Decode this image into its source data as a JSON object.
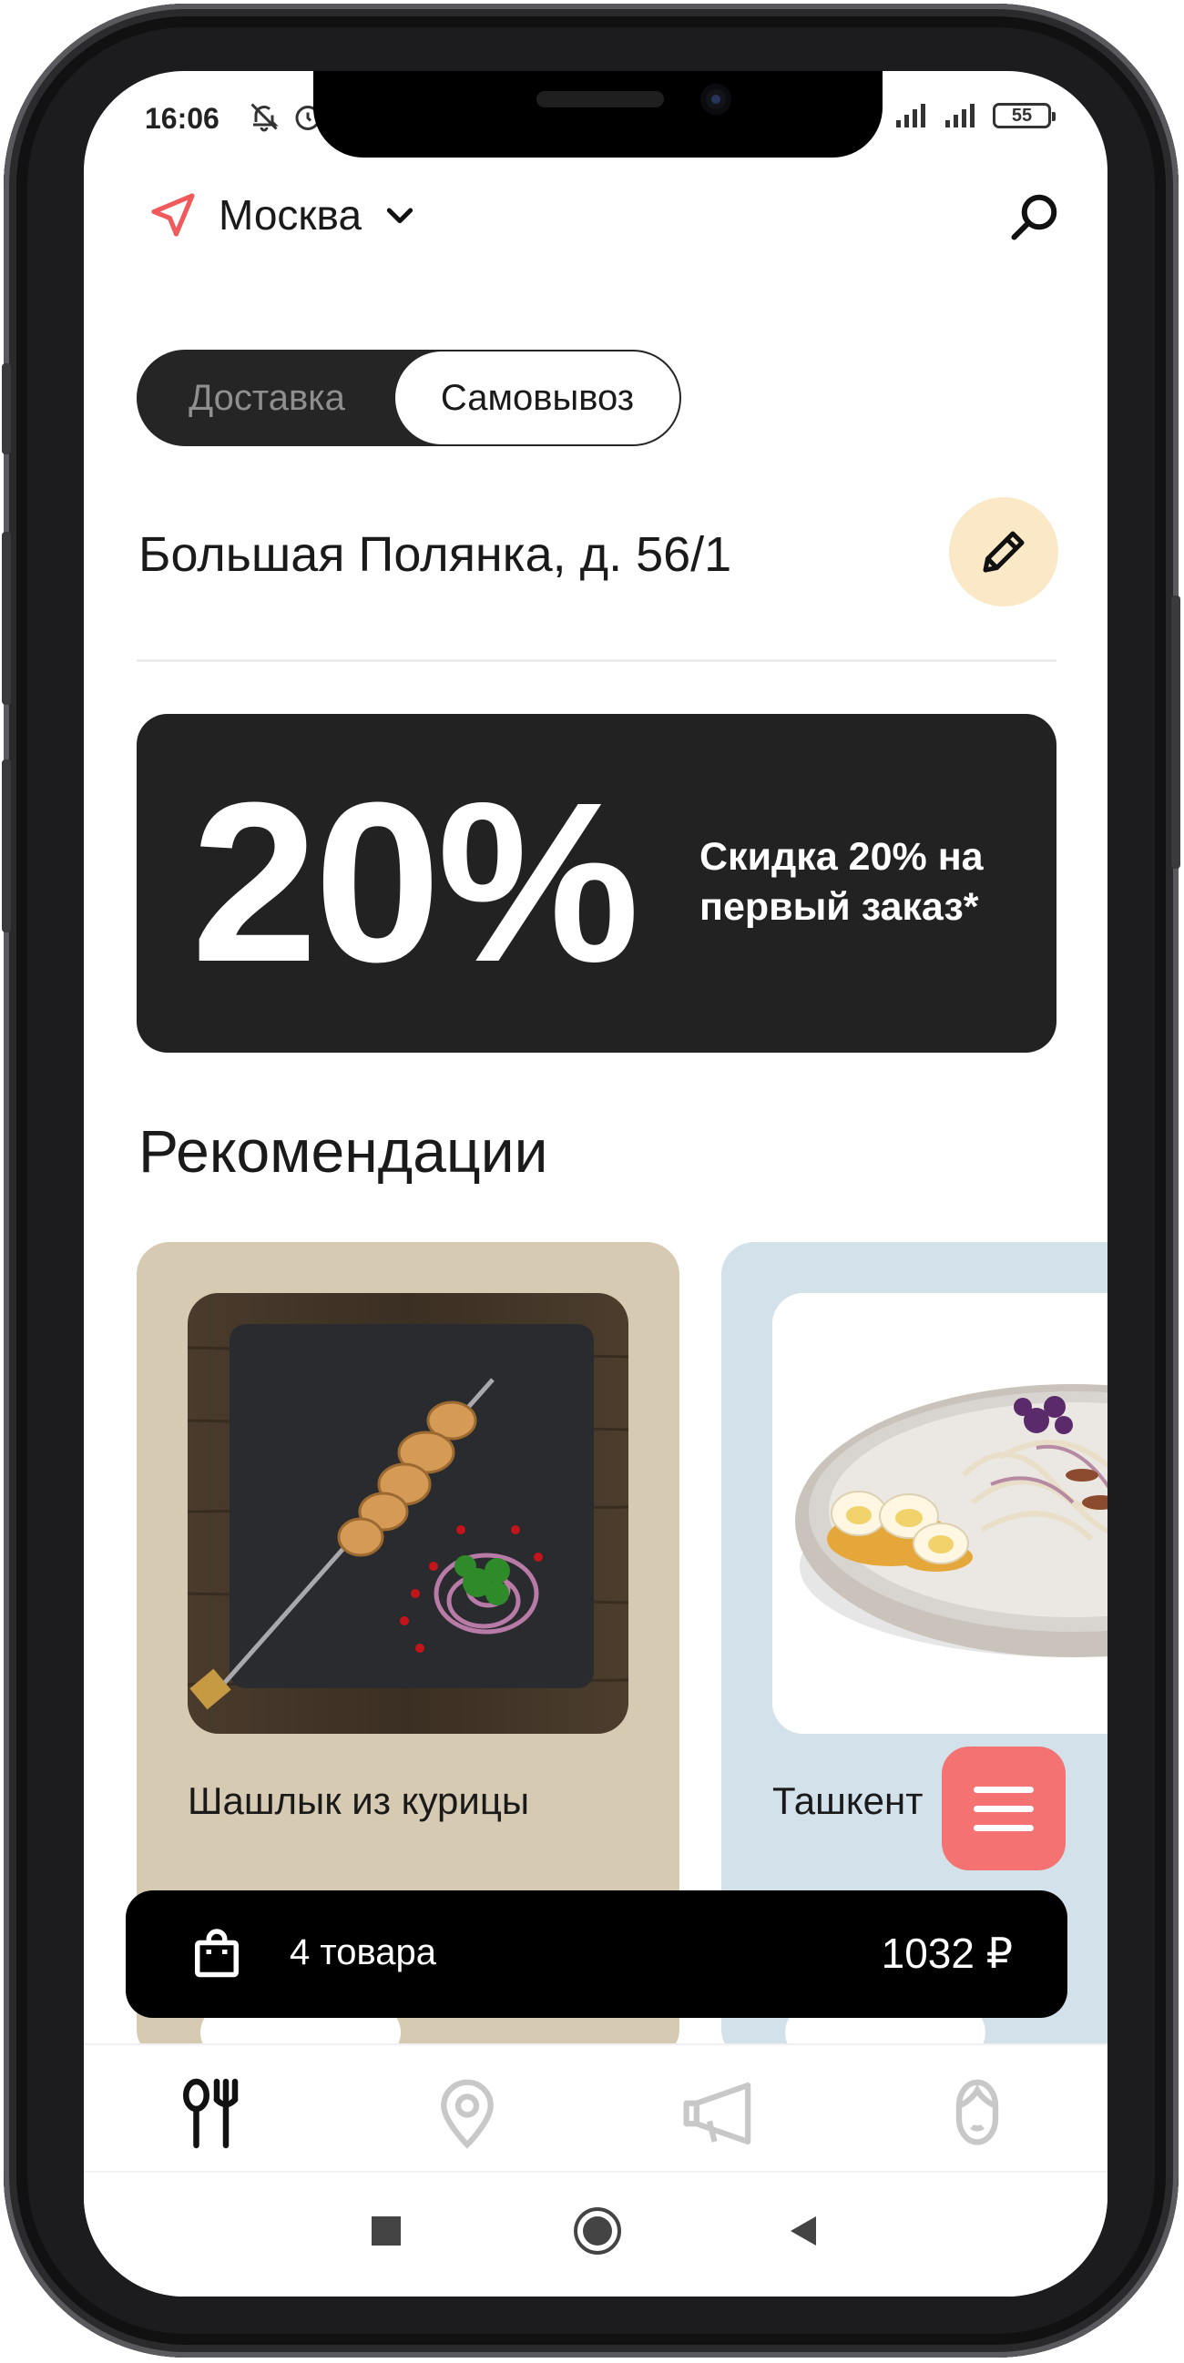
{
  "status_bar": {
    "time": "16:06",
    "battery": "55"
  },
  "header": {
    "city": "Москва"
  },
  "delivery_toggle": {
    "options": [
      "Доставка",
      "Самовывоз"
    ],
    "selected": "Самовывоз"
  },
  "address": {
    "text": "Большая Полянка, д. 56/1"
  },
  "promo": {
    "big_text": "20%",
    "text": "Скидка 20% на первый заказ*"
  },
  "recommendations": {
    "title": "Рекомендации",
    "items": [
      {
        "name": "Шашлык из курицы"
      },
      {
        "name": "Ташкент"
      }
    ]
  },
  "cart": {
    "count_label": "4 товара",
    "total": "1032 ₽"
  },
  "bottom_nav": {
    "items": [
      "menu-icon",
      "location-pin-icon",
      "megaphone-icon",
      "profile-icon"
    ],
    "active": "menu-icon"
  },
  "colors": {
    "accent": "#f47372",
    "dark": "#222222",
    "edit_bg": "#fbe8c6",
    "card1_bg": "#d6cab3",
    "card2_bg": "#d3e1eb"
  }
}
